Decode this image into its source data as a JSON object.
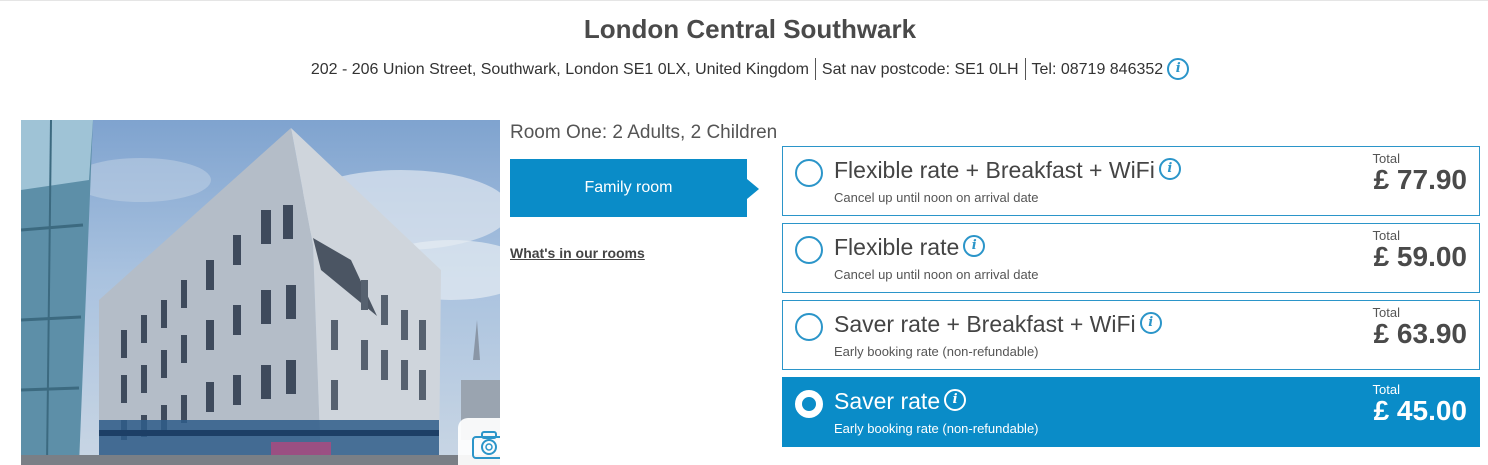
{
  "hotel": {
    "name": "London Central Southwark",
    "address": "202 - 206 Union Street, Southwark, London SE1 0LX, United Kingdom",
    "sat_nav": "Sat nav postcode: SE1 0LH",
    "tel": "Tel: 08719 846352",
    "info_icon": "i"
  },
  "photo": {
    "alt": "Hotel exterior photo",
    "gallery_icon": "camera-icon"
  },
  "room": {
    "heading": "Room One: 2 Adults, 2 Children",
    "type_label": "Family room",
    "rooms_link": "What's in our rooms"
  },
  "rates": [
    {
      "name": "Flexible rate + Breakfast + WiFi",
      "description": "Cancel up until noon on arrival date",
      "total_label": "Total",
      "price": "£ 77.90",
      "selected": false
    },
    {
      "name": "Flexible rate",
      "description": "Cancel up until noon on arrival date",
      "total_label": "Total",
      "price": "£ 59.00",
      "selected": false
    },
    {
      "name": "Saver rate + Breakfast + WiFi",
      "description": "Early booking rate (non-refundable)",
      "total_label": "Total",
      "price": "£ 63.90",
      "selected": false
    },
    {
      "name": "Saver rate",
      "description": "Early booking rate (non-refundable)",
      "total_label": "Total",
      "price": "£ 45.00",
      "selected": true
    }
  ],
  "colors": {
    "accent": "#0a8cc8",
    "border": "#2b95c9",
    "text": "#444444"
  }
}
